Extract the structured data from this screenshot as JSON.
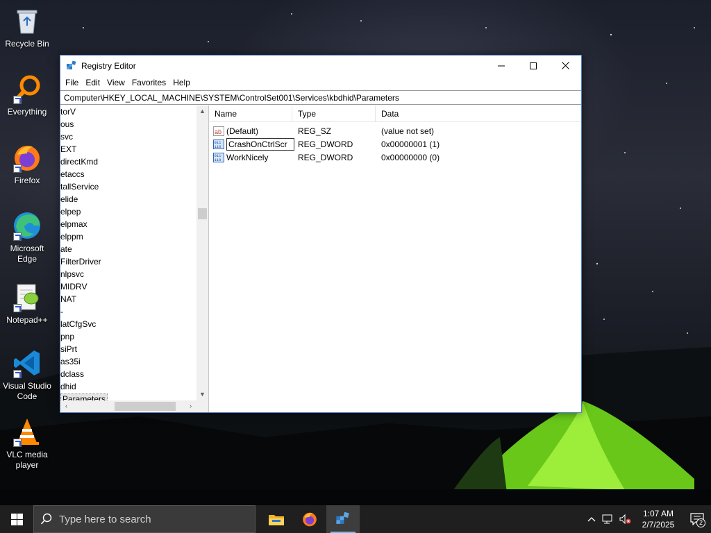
{
  "desktop": {
    "icons": [
      {
        "label": "Recycle Bin",
        "icon": "recycle-bin-icon"
      },
      {
        "label": "Everything",
        "icon": "everything-search-icon"
      },
      {
        "label": "Firefox",
        "icon": "firefox-icon"
      },
      {
        "label": "Microsoft Edge",
        "icon": "edge-icon"
      },
      {
        "label": "Notepad++",
        "icon": "notepadpp-icon"
      },
      {
        "label": "Visual Studio Code",
        "icon": "vscode-icon"
      },
      {
        "label": "VLC media player",
        "icon": "vlc-icon"
      }
    ]
  },
  "window": {
    "title": "Registry Editor",
    "menu": [
      "File",
      "Edit",
      "View",
      "Favorites",
      "Help"
    ],
    "address": "Computer\\HKEY_LOCAL_MACHINE\\SYSTEM\\ControlSet001\\Services\\kbdhid\\Parameters",
    "tree": [
      "torV",
      "ous",
      "svc",
      "EXT",
      "directKmd",
      "etaccs",
      "tallService",
      "elide",
      "elpep",
      "elpmax",
      "elppm",
      "ate",
      "FilterDriver",
      "nlpsvc",
      "MIDRV",
      "NAT",
      "-",
      "latCfgSvc",
      "pnp",
      "siPrt",
      "as35i",
      "dclass",
      "dhid",
      "Parameters"
    ],
    "columns": {
      "name": "Name",
      "type": "Type",
      "data": "Data"
    },
    "values": [
      {
        "name": "(Default)",
        "type": "REG_SZ",
        "data": "(value not set)",
        "icon": "string-value-icon"
      },
      {
        "name": "CrashOnCtrlScr",
        "type": "REG_DWORD",
        "data": "0x00000001 (1)",
        "icon": "dword-value-icon",
        "editing": true
      },
      {
        "name": "WorkNicely",
        "type": "REG_DWORD",
        "data": "0x00000000 (0)",
        "icon": "dword-value-icon"
      }
    ]
  },
  "taskbar": {
    "search_placeholder": "Type here to search",
    "time": "1:07 AM",
    "date": "2/7/2025",
    "notification_count": "2"
  }
}
